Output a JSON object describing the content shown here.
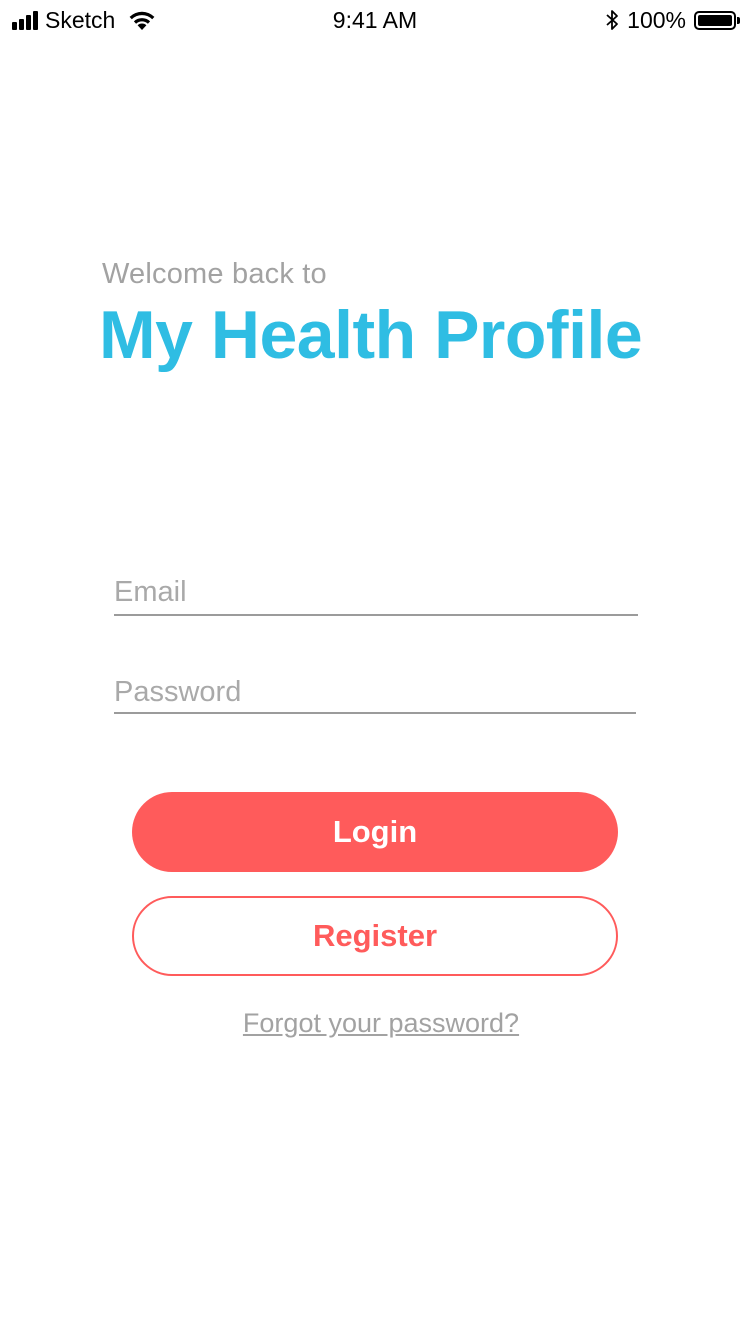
{
  "status_bar": {
    "carrier": "Sketch",
    "time": "9:41 AM",
    "battery_percent": "100%",
    "battery_level": 1.0,
    "icons": [
      "cellular-signal-icon",
      "wifi-icon",
      "bluetooth-icon",
      "battery-icon"
    ]
  },
  "header": {
    "welcome": "Welcome back to",
    "title": "My Health Profile"
  },
  "form": {
    "email_placeholder": "Email",
    "email_value": "",
    "password_placeholder": "Password",
    "password_value": ""
  },
  "actions": {
    "login_label": "Login",
    "register_label": "Register",
    "forgot_label": "Forgot your password?"
  },
  "colors": {
    "brand_blue": "#2fbde3",
    "accent_red": "#ff5b5b",
    "muted_gray": "#a2a2a2"
  }
}
